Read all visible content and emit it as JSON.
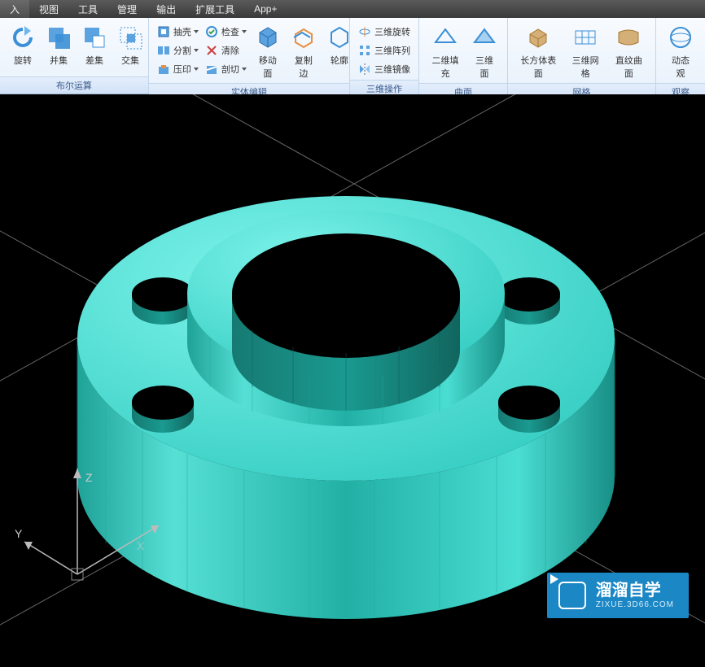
{
  "menu": [
    "入",
    "视图",
    "工具",
    "管理",
    "输出",
    "扩展工具",
    "App+"
  ],
  "groups": [
    {
      "label": "布尔运算",
      "items": [
        {
          "type": "large",
          "name": "rotate-button",
          "icon": "rotate",
          "label": "旋转",
          "arrow": true
        },
        {
          "type": "large",
          "name": "union-button",
          "icon": "union",
          "label": "并集"
        },
        {
          "type": "large",
          "name": "subtract-button",
          "icon": "subtract",
          "label": "差集"
        },
        {
          "type": "large",
          "name": "intersect-button",
          "icon": "intersect",
          "label": "交集"
        }
      ]
    },
    {
      "label": "实体编辑",
      "items": [
        {
          "type": "col",
          "name": "col-shell",
          "items": [
            {
              "name": "shell-button",
              "icon": "shell",
              "label": "抽壳",
              "arrow": true
            },
            {
              "name": "split-button",
              "icon": "split",
              "label": "分割",
              "arrow": true
            },
            {
              "name": "imprint-button",
              "icon": "imprint",
              "label": "压印",
              "arrow": true
            }
          ]
        },
        {
          "type": "col",
          "name": "col-check",
          "items": [
            {
              "name": "check-button",
              "icon": "check",
              "label": "检查",
              "arrow": true
            },
            {
              "name": "cleanup-button",
              "icon": "cleanup",
              "label": "清除"
            },
            {
              "name": "slice-button",
              "icon": "slice",
              "label": "剖切",
              "arrow": true
            }
          ]
        },
        {
          "type": "large",
          "name": "moveface-button",
          "icon": "moveface",
          "label": "移动面",
          "arrow": true
        },
        {
          "type": "large",
          "name": "copyedge-button",
          "icon": "copyedge",
          "label": "复制边",
          "arrow": true
        },
        {
          "type": "large",
          "name": "silhouette-button",
          "icon": "silhouette",
          "label": "轮廓"
        }
      ]
    },
    {
      "label": "三维操作",
      "items": [
        {
          "type": "col",
          "name": "col-3d",
          "items": [
            {
              "name": "revolve3d-button",
              "icon": "rev3d",
              "label": "三维旋转"
            },
            {
              "name": "array3d-button",
              "icon": "arr3d",
              "label": "三维阵列"
            },
            {
              "name": "mirror3d-button",
              "icon": "mir3d",
              "label": "三维镜像"
            }
          ]
        }
      ]
    },
    {
      "label": "曲面",
      "items": [
        {
          "type": "large",
          "name": "fill2d-button",
          "icon": "fill2d",
          "label": "二维填充"
        },
        {
          "type": "large",
          "name": "surf3d-button",
          "icon": "surf3d",
          "label": "三维面"
        }
      ]
    },
    {
      "label": "网格",
      "items": [
        {
          "type": "large",
          "name": "boxsurf-button",
          "icon": "boxsurf",
          "label": "长方体表面",
          "arrow": true
        },
        {
          "type": "large",
          "name": "mesh3d-button",
          "icon": "mesh3d",
          "label": "三维网格"
        },
        {
          "type": "large",
          "name": "ruled-button",
          "icon": "ruled",
          "label": "直纹曲面"
        }
      ]
    },
    {
      "label": "观察",
      "items": [
        {
          "type": "large",
          "name": "dynview-button",
          "icon": "dynview",
          "label": "动态观"
        }
      ]
    }
  ],
  "ucs": {
    "x": "X",
    "y": "Y",
    "z": "Z"
  },
  "watermark": {
    "title": "溜溜自学",
    "sub": "ZIXUE.3D66.COM"
  }
}
